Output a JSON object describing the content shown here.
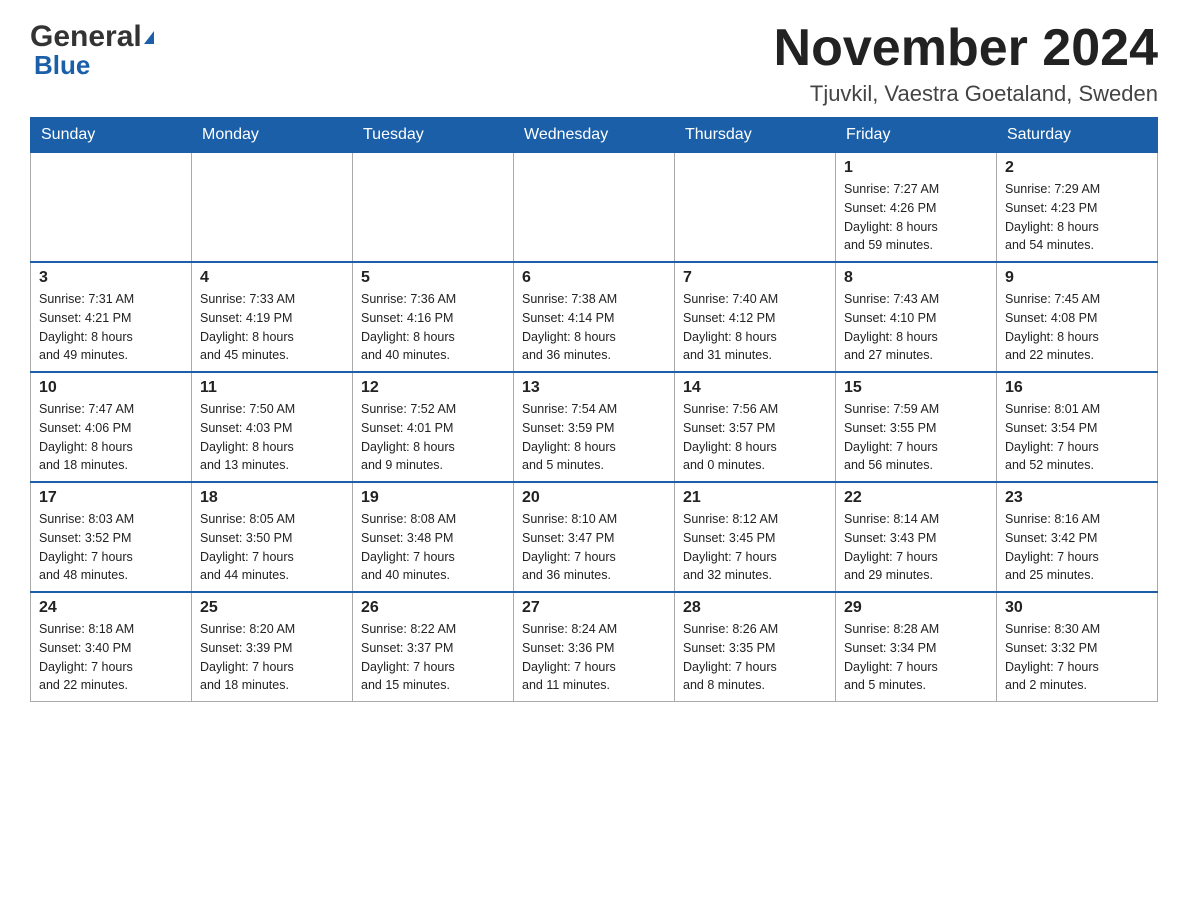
{
  "logo": {
    "text1": "General",
    "text2": "Blue"
  },
  "header": {
    "month": "November 2024",
    "location": "Tjuvkil, Vaestra Goetaland, Sweden"
  },
  "weekdays": [
    "Sunday",
    "Monday",
    "Tuesday",
    "Wednesday",
    "Thursday",
    "Friday",
    "Saturday"
  ],
  "weeks": [
    [
      {
        "day": "",
        "info": ""
      },
      {
        "day": "",
        "info": ""
      },
      {
        "day": "",
        "info": ""
      },
      {
        "day": "",
        "info": ""
      },
      {
        "day": "",
        "info": ""
      },
      {
        "day": "1",
        "info": "Sunrise: 7:27 AM\nSunset: 4:26 PM\nDaylight: 8 hours\nand 59 minutes."
      },
      {
        "day": "2",
        "info": "Sunrise: 7:29 AM\nSunset: 4:23 PM\nDaylight: 8 hours\nand 54 minutes."
      }
    ],
    [
      {
        "day": "3",
        "info": "Sunrise: 7:31 AM\nSunset: 4:21 PM\nDaylight: 8 hours\nand 49 minutes."
      },
      {
        "day": "4",
        "info": "Sunrise: 7:33 AM\nSunset: 4:19 PM\nDaylight: 8 hours\nand 45 minutes."
      },
      {
        "day": "5",
        "info": "Sunrise: 7:36 AM\nSunset: 4:16 PM\nDaylight: 8 hours\nand 40 minutes."
      },
      {
        "day": "6",
        "info": "Sunrise: 7:38 AM\nSunset: 4:14 PM\nDaylight: 8 hours\nand 36 minutes."
      },
      {
        "day": "7",
        "info": "Sunrise: 7:40 AM\nSunset: 4:12 PM\nDaylight: 8 hours\nand 31 minutes."
      },
      {
        "day": "8",
        "info": "Sunrise: 7:43 AM\nSunset: 4:10 PM\nDaylight: 8 hours\nand 27 minutes."
      },
      {
        "day": "9",
        "info": "Sunrise: 7:45 AM\nSunset: 4:08 PM\nDaylight: 8 hours\nand 22 minutes."
      }
    ],
    [
      {
        "day": "10",
        "info": "Sunrise: 7:47 AM\nSunset: 4:06 PM\nDaylight: 8 hours\nand 18 minutes."
      },
      {
        "day": "11",
        "info": "Sunrise: 7:50 AM\nSunset: 4:03 PM\nDaylight: 8 hours\nand 13 minutes."
      },
      {
        "day": "12",
        "info": "Sunrise: 7:52 AM\nSunset: 4:01 PM\nDaylight: 8 hours\nand 9 minutes."
      },
      {
        "day": "13",
        "info": "Sunrise: 7:54 AM\nSunset: 3:59 PM\nDaylight: 8 hours\nand 5 minutes."
      },
      {
        "day": "14",
        "info": "Sunrise: 7:56 AM\nSunset: 3:57 PM\nDaylight: 8 hours\nand 0 minutes."
      },
      {
        "day": "15",
        "info": "Sunrise: 7:59 AM\nSunset: 3:55 PM\nDaylight: 7 hours\nand 56 minutes."
      },
      {
        "day": "16",
        "info": "Sunrise: 8:01 AM\nSunset: 3:54 PM\nDaylight: 7 hours\nand 52 minutes."
      }
    ],
    [
      {
        "day": "17",
        "info": "Sunrise: 8:03 AM\nSunset: 3:52 PM\nDaylight: 7 hours\nand 48 minutes."
      },
      {
        "day": "18",
        "info": "Sunrise: 8:05 AM\nSunset: 3:50 PM\nDaylight: 7 hours\nand 44 minutes."
      },
      {
        "day": "19",
        "info": "Sunrise: 8:08 AM\nSunset: 3:48 PM\nDaylight: 7 hours\nand 40 minutes."
      },
      {
        "day": "20",
        "info": "Sunrise: 8:10 AM\nSunset: 3:47 PM\nDaylight: 7 hours\nand 36 minutes."
      },
      {
        "day": "21",
        "info": "Sunrise: 8:12 AM\nSunset: 3:45 PM\nDaylight: 7 hours\nand 32 minutes."
      },
      {
        "day": "22",
        "info": "Sunrise: 8:14 AM\nSunset: 3:43 PM\nDaylight: 7 hours\nand 29 minutes."
      },
      {
        "day": "23",
        "info": "Sunrise: 8:16 AM\nSunset: 3:42 PM\nDaylight: 7 hours\nand 25 minutes."
      }
    ],
    [
      {
        "day": "24",
        "info": "Sunrise: 8:18 AM\nSunset: 3:40 PM\nDaylight: 7 hours\nand 22 minutes."
      },
      {
        "day": "25",
        "info": "Sunrise: 8:20 AM\nSunset: 3:39 PM\nDaylight: 7 hours\nand 18 minutes."
      },
      {
        "day": "26",
        "info": "Sunrise: 8:22 AM\nSunset: 3:37 PM\nDaylight: 7 hours\nand 15 minutes."
      },
      {
        "day": "27",
        "info": "Sunrise: 8:24 AM\nSunset: 3:36 PM\nDaylight: 7 hours\nand 11 minutes."
      },
      {
        "day": "28",
        "info": "Sunrise: 8:26 AM\nSunset: 3:35 PM\nDaylight: 7 hours\nand 8 minutes."
      },
      {
        "day": "29",
        "info": "Sunrise: 8:28 AM\nSunset: 3:34 PM\nDaylight: 7 hours\nand 5 minutes."
      },
      {
        "day": "30",
        "info": "Sunrise: 8:30 AM\nSunset: 3:32 PM\nDaylight: 7 hours\nand 2 minutes."
      }
    ]
  ]
}
